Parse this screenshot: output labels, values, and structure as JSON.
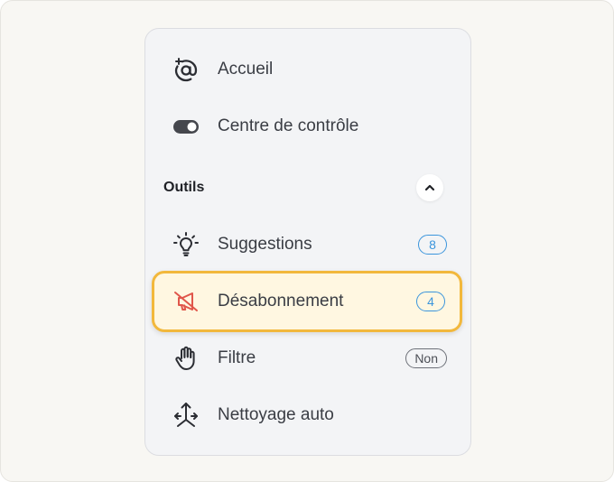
{
  "nav": {
    "items": [
      {
        "label": "Accueil",
        "icon": "at-sparkle-icon"
      },
      {
        "label": "Centre de contrôle",
        "icon": "toggle-icon"
      }
    ]
  },
  "tools": {
    "title": "Outils",
    "collapse_icon": "chevron-up-icon",
    "items": [
      {
        "label": "Suggestions",
        "icon": "lightbulb-icon",
        "badge": "8"
      },
      {
        "label": "Désabonnement",
        "icon": "muted-megaphone-icon",
        "badge": "4",
        "active": true
      },
      {
        "label": "Filtre",
        "icon": "hand-icon",
        "badge": "Non"
      },
      {
        "label": "Nettoyage auto",
        "icon": "arrows-icon"
      }
    ]
  },
  "colors": {
    "accent_badge": "#3b95dc",
    "active_border": "#f2b83c",
    "active_bg": "#fff7e1",
    "active_icon": "#e0564a"
  }
}
